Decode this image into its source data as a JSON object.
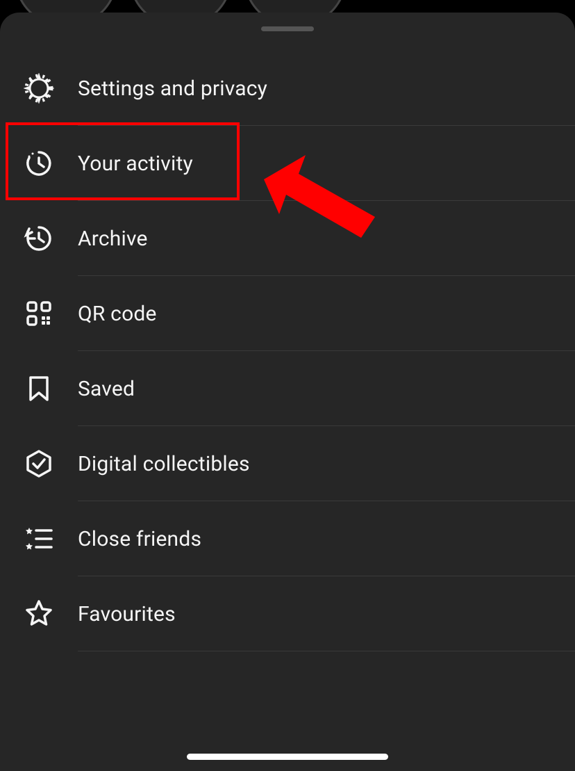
{
  "menu": {
    "items": [
      {
        "label": "Settings and privacy",
        "icon": "settings"
      },
      {
        "label": "Your activity",
        "icon": "activity"
      },
      {
        "label": "Archive",
        "icon": "archive"
      },
      {
        "label": "QR code",
        "icon": "qr"
      },
      {
        "label": "Saved",
        "icon": "saved"
      },
      {
        "label": "Digital collectibles",
        "icon": "collectibles"
      },
      {
        "label": "Close friends",
        "icon": "closefriends"
      },
      {
        "label": "Favourites",
        "icon": "favourites"
      }
    ]
  },
  "annotation": {
    "highlight_index": 1,
    "arrow_color": "#ff0000"
  }
}
